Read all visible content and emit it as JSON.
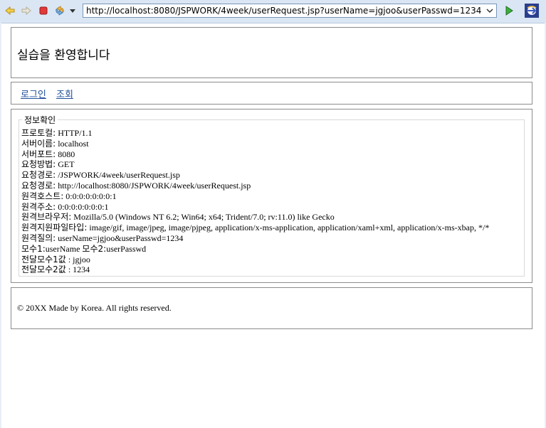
{
  "browser": {
    "url": "http://localhost:8080/JSPWORK/4week/userRequest.jsp?userName=jgjoo&userPasswd=1234",
    "icons": [
      "back-arrow",
      "forward-arrow",
      "stop",
      "refresh",
      "dropdown",
      "go",
      "eclipse-browser"
    ]
  },
  "header": {
    "title": "실습을 환영합니다"
  },
  "nav": {
    "login": "로그인",
    "lookup": "조회"
  },
  "info": {
    "legend": "정보확인",
    "rows": [
      {
        "label": "프로토컬:",
        "value": " HTTP/1.1"
      },
      {
        "label": "서버이름:",
        "value": " localhost"
      },
      {
        "label": "서버포트:",
        "value": " 8080"
      },
      {
        "label": "요청방법:",
        "value": " GET"
      },
      {
        "label": "요청경로:",
        "value": " /JSPWORK/4week/userRequest.jsp"
      },
      {
        "label": "요청경로:",
        "value": " http://localhost:8080/JSPWORK/4week/userRequest.jsp"
      },
      {
        "label": "원격호스트:",
        "value": " 0:0:0:0:0:0:0:1"
      },
      {
        "label": "원격주소:",
        "value": " 0:0:0:0:0:0:0:1"
      },
      {
        "label": "원격브라우저:",
        "value": " Mozilla/5.0 (Windows NT 6.2; Win64; x64; Trident/7.0; rv:11.0) like Gecko"
      },
      {
        "label": "원격지원파일타입:",
        "value": " image/gif, image/jpeg, image/pjpeg, application/x-ms-application, application/xaml+xml, application/x-ms-xbap, */*"
      },
      {
        "label": "원격질의:",
        "value": " userName=jgjoo&userPasswd=1234"
      },
      {
        "label": "모수1:",
        "value": "userName "
      },
      {
        "label": "전달모수1값",
        "value": " : jgjoo"
      },
      {
        "label": "전달모수2값",
        "value": " : 1234"
      }
    ],
    "param2_label": "모수2:",
    "param2_value": "userPasswd"
  },
  "footer": {
    "text": "© 20XX Made by Korea. All rights reserved."
  },
  "colors": {
    "link": "#1f4f9a",
    "border": "#8c8c8c",
    "toolbar": "#dbe6f4"
  }
}
